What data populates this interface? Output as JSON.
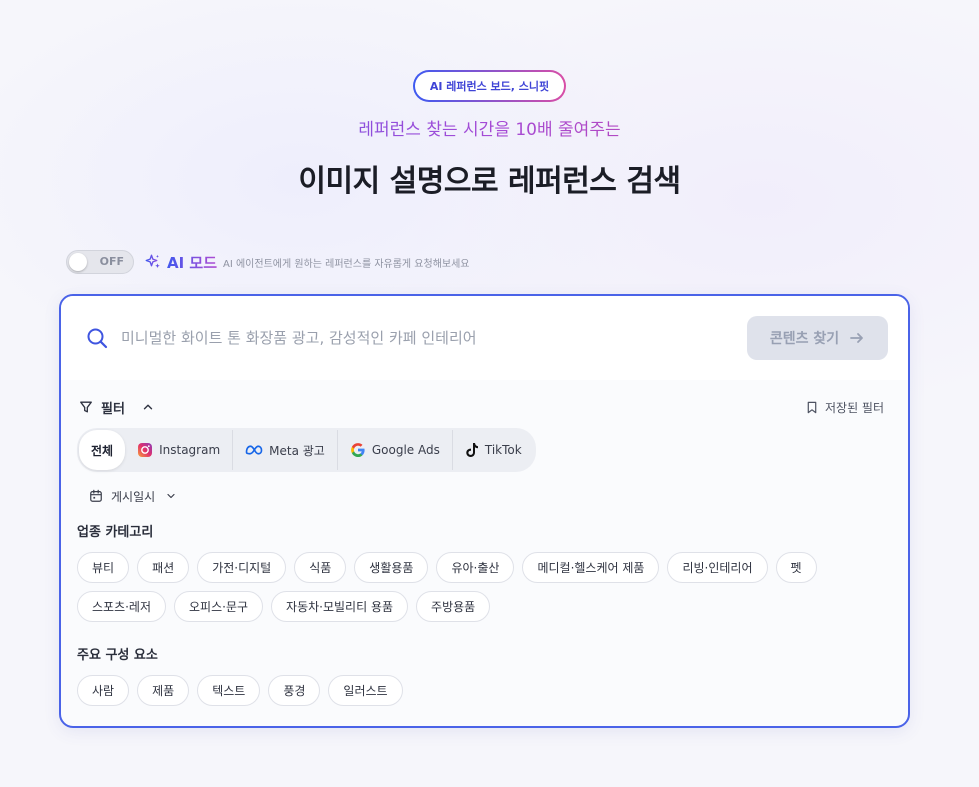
{
  "hero": {
    "badge": "AI 레퍼런스 보드, 스니핏",
    "subtitle": "레퍼런스 찾는 시간을 10배 줄여주는",
    "title": "이미지 설명으로 레퍼런스 검색"
  },
  "ai_mode": {
    "toggle_state": "OFF",
    "label": "AI 모드",
    "description": "AI 에이전트에게 원하는 레퍼런스를 자유롭게 요청해보세요"
  },
  "search": {
    "placeholder": "미니멀한 화이트 톤 화장품 광고, 감성적인 카페 인테리어",
    "value": "",
    "button_label": "콘텐츠 찾기"
  },
  "filter": {
    "label": "필터",
    "saved_label": "저장된 필터",
    "platforms": [
      {
        "label": "전체",
        "icon": "none"
      },
      {
        "label": "Instagram",
        "icon": "instagram-icon"
      },
      {
        "label": "Meta 광고",
        "icon": "meta-icon"
      },
      {
        "label": "Google Ads",
        "icon": "google-icon"
      },
      {
        "label": "TikTok",
        "icon": "tiktok-icon"
      }
    ],
    "date_label": "게시일시"
  },
  "categories": {
    "title": "업종 카테고리",
    "items": [
      "뷰티",
      "패션",
      "가전·디지털",
      "식품",
      "생활용품",
      "유아·출산",
      "메디컬·헬스케어 제품",
      "리빙·인테리어",
      "펫",
      "스포츠·레저",
      "오피스·문구",
      "자동차·모빌리티 용품",
      "주방용품"
    ]
  },
  "elements": {
    "title": "주요 구성 요소",
    "items": [
      "사람",
      "제품",
      "텍스트",
      "풍경",
      "일러스트"
    ]
  },
  "colors": {
    "accent": "#4a63e8",
    "gradient_start": "#3d5af1",
    "gradient_end": "#d94ea6"
  }
}
